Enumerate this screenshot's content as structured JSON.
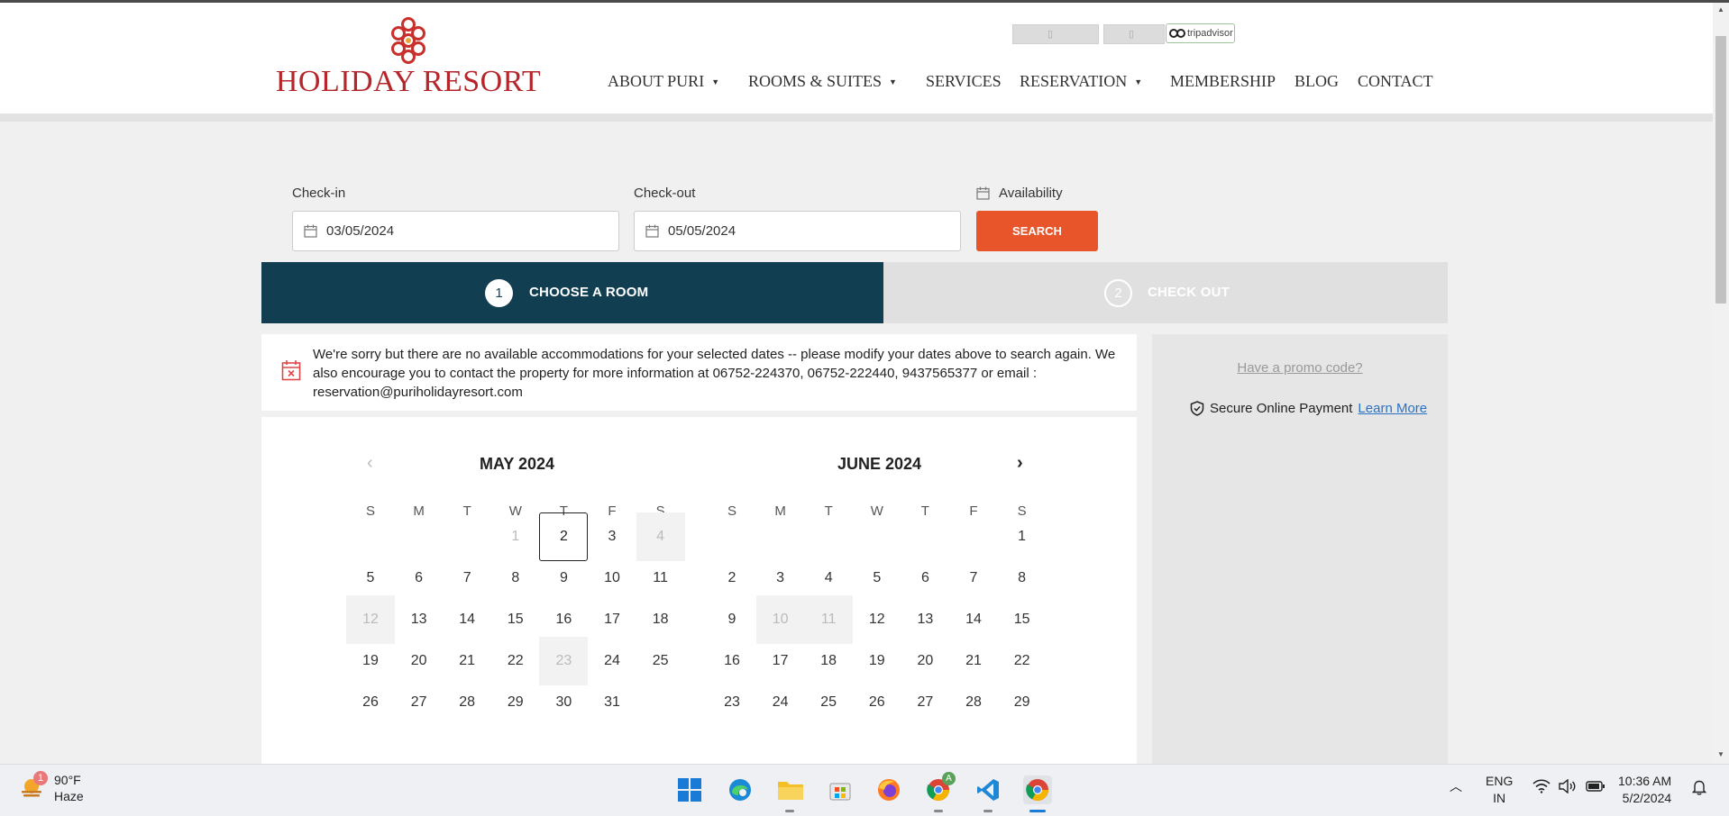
{
  "header": {
    "logo_text": "HOLIDAY RESORT",
    "tripadvisor_label": "tripadvisor",
    "nav": [
      {
        "label": "ABOUT PURI",
        "dropdown": true
      },
      {
        "label": "ROOMS & SUITES",
        "dropdown": true
      },
      {
        "label": "SERVICES",
        "dropdown": false
      },
      {
        "label": "RESERVATION",
        "dropdown": true
      },
      {
        "label": "MEMBERSHIP",
        "dropdown": false
      },
      {
        "label": "BLOG",
        "dropdown": false
      },
      {
        "label": "CONTACT",
        "dropdown": false
      }
    ]
  },
  "search": {
    "checkin_label": "Check-in",
    "checkin_value": "03/05/2024",
    "checkout_label": "Check-out",
    "checkout_value": "05/05/2024",
    "availability_label": "Availability",
    "search_button": "SEARCH"
  },
  "steps": [
    {
      "num": "1",
      "label": "CHOOSE A ROOM",
      "active": true
    },
    {
      "num": "2",
      "label": "CHECK OUT",
      "active": false
    }
  ],
  "notice": {
    "text": "We're sorry but there are no available accommodations for your selected dates -- please modify your dates above to search again. We also encourage you to contact the property for more information at 06752-224370, 06752-222440, 9437565377 or email : reservation@puriholidayresort.com"
  },
  "side": {
    "promo": "Have a promo code?",
    "secure": "Secure Online Payment",
    "learn_more": "Learn More"
  },
  "calendar": {
    "prev_arrow": "‹",
    "next_arrow": "›",
    "weekdays": [
      "S",
      "M",
      "T",
      "W",
      "T",
      "F",
      "S"
    ],
    "months": [
      {
        "title": "MAY 2024",
        "weeks": [
          [
            "",
            "",
            "",
            "1",
            "2",
            "3",
            "4"
          ],
          [
            "5",
            "6",
            "7",
            "8",
            "9",
            "10",
            "11"
          ],
          [
            "12",
            "13",
            "14",
            "15",
            "16",
            "17",
            "18"
          ],
          [
            "19",
            "20",
            "21",
            "22",
            "23",
            "24",
            "25"
          ],
          [
            "26",
            "27",
            "28",
            "29",
            "30",
            "31",
            ""
          ]
        ],
        "disabled": [
          "1"
        ],
        "today": "2",
        "shaded": [
          "4",
          "12",
          "23"
        ]
      },
      {
        "title": "JUNE 2024",
        "weeks": [
          [
            "",
            "",
            "",
            "",
            "",
            "",
            "1"
          ],
          [
            "2",
            "3",
            "4",
            "5",
            "6",
            "7",
            "8"
          ],
          [
            "9",
            "10",
            "11",
            "12",
            "13",
            "14",
            "15"
          ],
          [
            "16",
            "17",
            "18",
            "19",
            "20",
            "21",
            "22"
          ],
          [
            "23",
            "24",
            "25",
            "26",
            "27",
            "28",
            "29"
          ]
        ],
        "disabled": [],
        "today": "",
        "shaded": [
          "10",
          "11"
        ]
      }
    ]
  },
  "taskbar": {
    "weather_temp": "90°F",
    "weather_desc": "Haze",
    "weather_badge": "1",
    "chrome_badge": "A",
    "lang_top": "ENG",
    "lang_bottom": "IN",
    "time": "10:36 AM",
    "date": "5/2/2024",
    "apps": [
      "windows-start-icon",
      "edge-icon",
      "file-explorer-icon",
      "microsoft-store-icon",
      "firefox-icon",
      "chrome-profile-icon",
      "vscode-icon",
      "chrome-icon"
    ]
  },
  "colors": {
    "brand_red": "#b5262b",
    "step_active": "#123e52",
    "search_button": "#e8552a",
    "link_blue": "#2b72c2"
  }
}
